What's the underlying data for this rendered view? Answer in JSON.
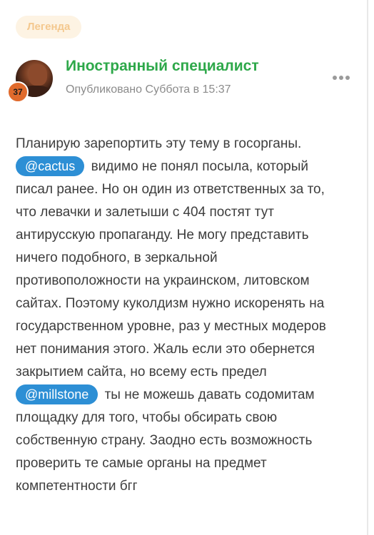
{
  "badge": {
    "label": "Легенда"
  },
  "post": {
    "author": "Иностранный специалист",
    "meta": "Опубликовано Суббота в 15:37",
    "rank_number": "37",
    "mentions": [
      "@cactus",
      "@millstone"
    ],
    "lines": [
      "Планирую зарепортить эту тему в госорганы.",
      "видимо не понял посыла, который",
      "писал ранее. Но он один из ответственных за то,",
      "что левачки и залетыши с 404 постят тут",
      "антирусскую пропаганду. Не могу представить",
      "ничего подобного, в зеркальной",
      "противоположности на украинском, литовском",
      "сайтах. Поэтому куколдизм нужно искоренять на",
      "государственном уровне, раз у местных модеров",
      "нет понимания этого. Жаль если это обернется",
      "закрытием сайта, но всему есть предел",
      "ты не можешь давать содомитам",
      "площадку для того, чтобы обсирать свою",
      "собственную страну. Заодно есть возможность",
      "проверить те самые органы на предмет",
      "компетентности бгг"
    ]
  },
  "icons": {
    "more": "more-options-icon",
    "avatar": "avatar-image"
  },
  "colors": {
    "author": "#2ea84a",
    "mention_bg": "#2d8fd5",
    "badge_bg": "#fdf3e3",
    "badge_text": "#f4c88e",
    "rank_bg": "#e06a2c"
  }
}
